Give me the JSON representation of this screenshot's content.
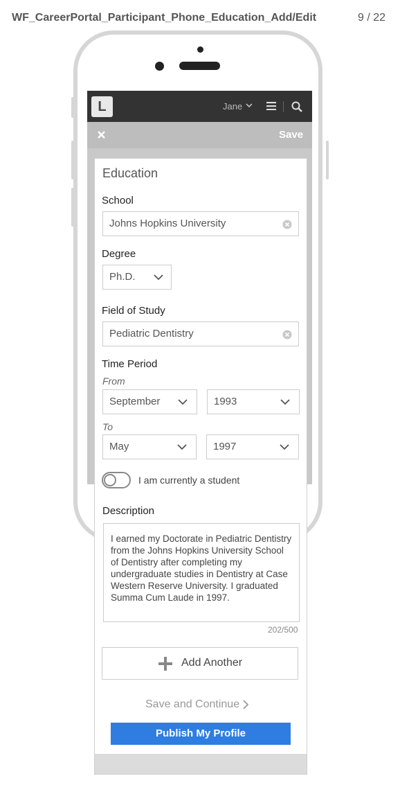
{
  "page": {
    "title": "WF_CareerPortal_Participant_Phone_Education_Add/Edit",
    "page_number": "9 / 22"
  },
  "topbar": {
    "logo": "L",
    "user_name": "Jane",
    "icons": [
      "chevron-down-icon",
      "menu-icon",
      "search-icon"
    ]
  },
  "actionbar": {
    "close_icon": "close-icon",
    "save_label": "Save"
  },
  "form": {
    "section_title": "Education",
    "school": {
      "label": "School",
      "value": "Johns Hopkins University"
    },
    "degree": {
      "label": "Degree",
      "value": "Ph.D."
    },
    "field_of_study": {
      "label": "Field of Study",
      "value": "Pediatric Dentistry"
    },
    "time_period": {
      "label": "Time Period",
      "from_label": "From",
      "from_month": "September",
      "from_year": "1993",
      "to_label": "To",
      "to_month": "May",
      "to_year": "1997"
    },
    "current_student": {
      "label": "I am currently a student",
      "checked": false
    },
    "description": {
      "label": "Description",
      "value": "I earned my Doctorate in Pediatric Dentistry from the Johns Hopkins University School of Dentistry after completing my undergraduate studies in Dentistry at Case Western Reserve University. I graduated Summa Cum Laude in 1997.",
      "char_count": "202/500"
    },
    "add_another_label": "Add Another",
    "save_continue_label": "Save and Continue",
    "publish_label": "Publish My Profile"
  },
  "colors": {
    "topbar": "#333333",
    "actionbar": "#bdbdbd",
    "primary": "#2f7de1"
  }
}
